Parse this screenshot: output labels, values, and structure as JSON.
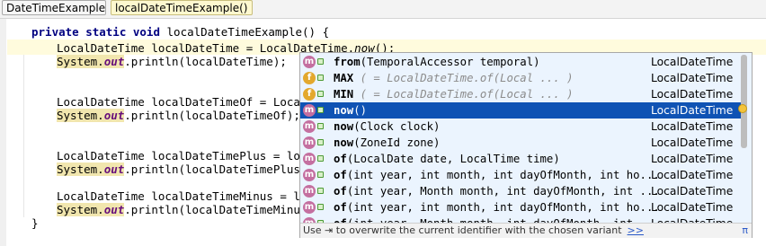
{
  "breadcrumbs": [
    "DateTimeExample",
    "localDateTimeExample()"
  ],
  "code": {
    "method_decl": {
      "mods": "private static void ",
      "name": "localDateTimeExample() {"
    },
    "line_now": {
      "pre": "LocalDateTime localDateTime = LocalDateTime.",
      "call": "now",
      "post": "();"
    },
    "sysout_1": {
      "cls": "System.",
      "field": "out",
      "rest": ".println(localDateTime);"
    },
    "line_of": "LocalDateTime localDateTimeOf = LocalDa",
    "sysout_2": {
      "cls": "System.",
      "field": "out",
      "rest": ".println(localDateTimeOf); //"
    },
    "line_plus": "LocalDateTime localDateTimePlus = local",
    "sysout_3": {
      "cls": "System.",
      "field": "out",
      "rest": ".println(localDateTimePlus);"
    },
    "line_minus": "LocalDateTime localDateTimeMinus = loca",
    "sysout_4": {
      "cls": "System.",
      "field": "out",
      "rest": ".println(localDateTimeMinus);"
    },
    "close_brace": "}"
  },
  "completion": {
    "items": [
      {
        "kind": "m",
        "name": "from",
        "args": "(TemporalAccessor temporal)",
        "tail": "",
        "type": "LocalDateTime",
        "selected": false
      },
      {
        "kind": "f",
        "name": "MAX",
        "args": "",
        "tail": " ( = LocalDateTime.of(Local ... )",
        "type": "LocalDateTime",
        "selected": false
      },
      {
        "kind": "f",
        "name": "MIN",
        "args": "",
        "tail": " ( = LocalDateTime.of(Local ... )",
        "type": "LocalDateTime",
        "selected": false
      },
      {
        "kind": "m",
        "name": "now",
        "args": "()",
        "tail": "",
        "type": "LocalDateTime",
        "selected": true
      },
      {
        "kind": "m",
        "name": "now",
        "args": "(Clock clock)",
        "tail": "",
        "type": "LocalDateTime",
        "selected": false
      },
      {
        "kind": "m",
        "name": "now",
        "args": "(ZoneId zone)",
        "tail": "",
        "type": "LocalDateTime",
        "selected": false
      },
      {
        "kind": "m",
        "name": "of",
        "args": "(LocalDate date, LocalTime time)",
        "tail": "",
        "type": "LocalDateTime",
        "selected": false
      },
      {
        "kind": "m",
        "name": "of",
        "args": "(int year, int month, int dayOfMonth, int ho...",
        "tail": "",
        "type": "LocalDateTime",
        "selected": false
      },
      {
        "kind": "m",
        "name": "of",
        "args": "(int year, Month month, int dayOfMonth, int ...",
        "tail": "",
        "type": "LocalDateTime",
        "selected": false
      },
      {
        "kind": "m",
        "name": "of",
        "args": "(int year, int month, int dayOfMonth, int ho...",
        "tail": "",
        "type": "LocalDateTime",
        "selected": false
      },
      {
        "kind": "m",
        "name": "of",
        "args": "(int year, Month month, int dayOfMonth, int ...",
        "tail": "",
        "type": "LocalDateTime",
        "selected": false
      }
    ],
    "footer_hint": "Use ⇥ to overwrite the current identifier with the chosen variant",
    "footer_more": ">>",
    "footer_pi": "π"
  }
}
